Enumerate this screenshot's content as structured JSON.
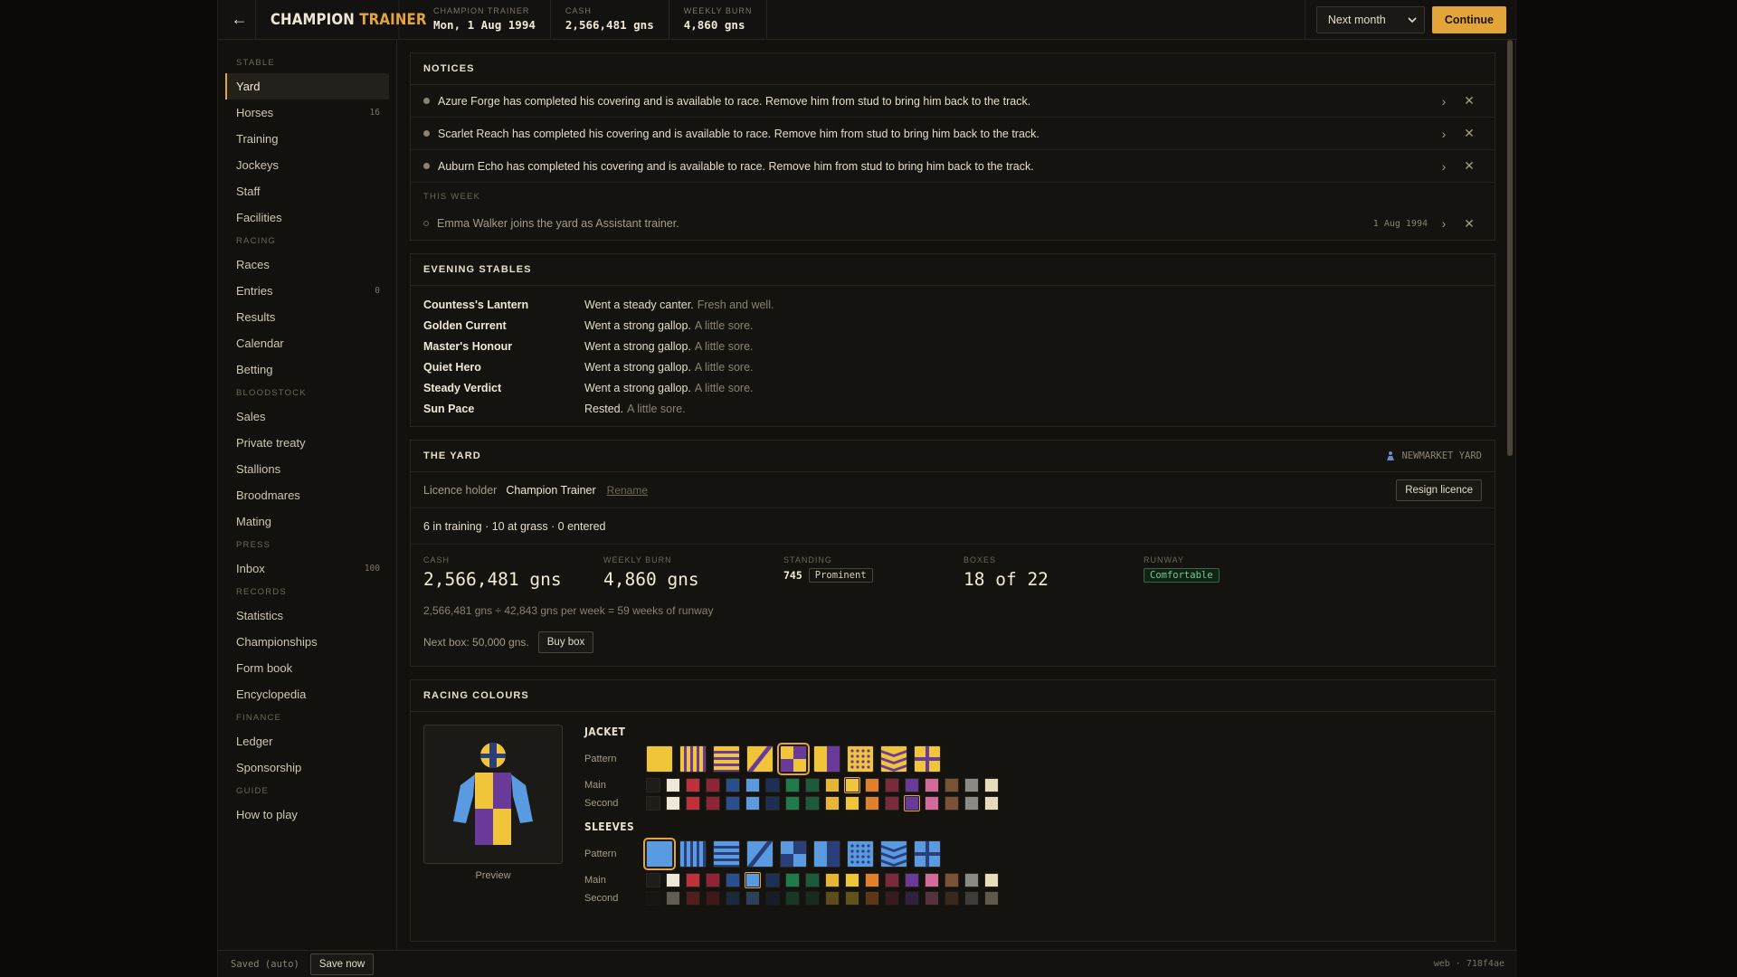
{
  "header": {
    "back_icon": "arrow-left-icon",
    "brand_a": "CHAMPION",
    "brand_b": "TRAINER",
    "stats": [
      {
        "label": "CHAMPION TRAINER",
        "value": "Mon, 1 Aug 1994"
      },
      {
        "label": "CASH",
        "value": "2,566,481 gns"
      },
      {
        "label": "WEEKLY BURN",
        "value": "4,860 gns"
      }
    ],
    "advance_select": "Next month",
    "continue_label": "Continue"
  },
  "sidebar": {
    "groups": [
      {
        "title": "STABLE",
        "items": [
          {
            "label": "Yard",
            "count": "",
            "active": true
          },
          {
            "label": "Horses",
            "count": "16"
          },
          {
            "label": "Training",
            "count": ""
          },
          {
            "label": "Jockeys",
            "count": ""
          },
          {
            "label": "Staff",
            "count": ""
          },
          {
            "label": "Facilities",
            "count": ""
          }
        ]
      },
      {
        "title": "RACING",
        "items": [
          {
            "label": "Races",
            "count": ""
          },
          {
            "label": "Entries",
            "count": "0"
          },
          {
            "label": "Results",
            "count": ""
          },
          {
            "label": "Calendar",
            "count": ""
          },
          {
            "label": "Betting",
            "count": ""
          }
        ]
      },
      {
        "title": "BLOODSTOCK",
        "items": [
          {
            "label": "Sales",
            "count": ""
          },
          {
            "label": "Private treaty",
            "count": ""
          },
          {
            "label": "Stallions",
            "count": ""
          },
          {
            "label": "Broodmares",
            "count": ""
          },
          {
            "label": "Mating",
            "count": ""
          }
        ]
      },
      {
        "title": "PRESS",
        "items": [
          {
            "label": "Inbox",
            "count": "100"
          }
        ]
      },
      {
        "title": "RECORDS",
        "items": [
          {
            "label": "Statistics",
            "count": ""
          },
          {
            "label": "Championships",
            "count": ""
          },
          {
            "label": "Form book",
            "count": ""
          },
          {
            "label": "Encyclopedia",
            "count": ""
          }
        ]
      },
      {
        "title": "FINANCE",
        "items": [
          {
            "label": "Ledger",
            "count": ""
          },
          {
            "label": "Sponsorship",
            "count": ""
          }
        ]
      },
      {
        "title": "GUIDE",
        "items": [
          {
            "label": "How to play",
            "count": ""
          }
        ]
      }
    ]
  },
  "notices": {
    "title": "NOTICES",
    "items": [
      "Azure Forge has completed his covering and is available to race. Remove him from stud to bring him back to the track.",
      "Scarlet Reach has completed his covering and is available to race. Remove him from stud to bring him back to the track.",
      "Auburn Echo has completed his covering and is available to race. Remove him from stud to bring him back to the track."
    ],
    "week_title": "THIS WEEK",
    "week_item": {
      "text": "Emma Walker joins the yard as Assistant trainer.",
      "date": "1 Aug 1994"
    },
    "open_glyph": "›",
    "dismiss_glyph": "✕"
  },
  "evening": {
    "title": "EVENING STABLES",
    "rows": [
      {
        "name": "Countess's Lantern",
        "work": "Went a steady canter.",
        "note": "Fresh and well."
      },
      {
        "name": "Golden Current",
        "work": "Went a strong gallop.",
        "note": "A little sore."
      },
      {
        "name": "Master's Honour",
        "work": "Went a strong gallop.",
        "note": "A little sore."
      },
      {
        "name": "Quiet Hero",
        "work": "Went a strong gallop.",
        "note": "A little sore."
      },
      {
        "name": "Steady Verdict",
        "work": "Went a strong gallop.",
        "note": "A little sore."
      },
      {
        "name": "Sun Pace",
        "work": "Rested.",
        "note": "A little sore."
      }
    ]
  },
  "yard": {
    "title": "THE YARD",
    "location": "Newmarket Yard",
    "licence_label": "Licence holder",
    "licence_holder": "Champion Trainer",
    "rename_label": "Rename",
    "resign_label": "Resign licence",
    "summary": "6 in training · 10 at grass · 0 entered",
    "kpis": {
      "cash_label": "CASH",
      "cash": "2,566,481 gns",
      "burn_label": "WEEKLY BURN",
      "burn": "4,860 gns",
      "standing_label": "STANDING",
      "standing": "745",
      "standing_tag": "Prominent",
      "boxes_label": "BOXES",
      "boxes": "18 of 22",
      "runway_label": "RUNWAY",
      "runway_tag": "Comfortable"
    },
    "runway_text": "2,566,481 gns ÷ 42,843 gns per week = 59 weeks of runway",
    "next_box": "Next box: 50,000 gns.",
    "buy_label": "Buy box"
  },
  "colours": {
    "title": "RACING COLOURS",
    "preview_label": "Preview",
    "jacket_title": "JACKET",
    "sleeves_title": "SLEEVES",
    "pattern_label": "Pattern",
    "main_label": "Main",
    "second_label": "Second",
    "patterns": [
      "plain",
      "stripes",
      "hoops",
      "sash",
      "quartered",
      "halves",
      "spots",
      "chevrons",
      "cross-belts"
    ],
    "palette": [
      "#1f1d1a",
      "#efe8d8",
      "#c0303a",
      "#8e2436",
      "#2a4f8e",
      "#5a9ae0",
      "#1c2f57",
      "#1f7a4c",
      "#1b5a3c",
      "#e6b634",
      "#f0c53a",
      "#e07f2c",
      "#7a2a3a",
      "#6a3a9a",
      "#d46a9a",
      "#7a5236",
      "#8a8a86",
      "#e6dcbc"
    ],
    "jacket": {
      "pattern": "quartered",
      "main": "#f0c53a",
      "second": "#6a3a9a",
      "second_alt": "#2a3f7a"
    },
    "sleeves": {
      "pattern": "plain",
      "main": "#5a9ae0",
      "second": "#1f1d1a"
    }
  },
  "footer": {
    "saved": "Saved (auto)",
    "save_now": "Save now",
    "version": "web · 718f4ae"
  }
}
